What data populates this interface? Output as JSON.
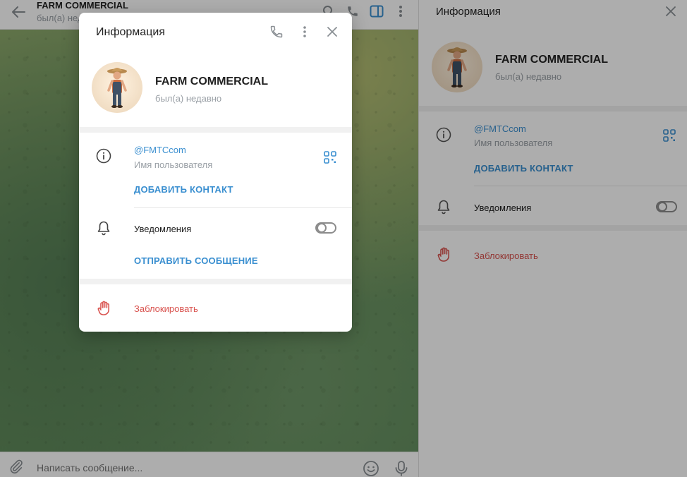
{
  "chat": {
    "title": "FARM COMMERCIAL",
    "subtitle": "был(а) недавно",
    "composer_placeholder": "Написать сообщение..."
  },
  "panel": {
    "title": "Информация",
    "name": "FARM COMMERCIAL",
    "status": "был(а) недавно",
    "username": "@FMTCcom",
    "username_label": "Имя пользователя",
    "add_contact": "ДОБАВИТЬ КОНТАКТ",
    "notifications": "Уведомления",
    "notifications_on": false,
    "block": "Заблокировать"
  },
  "modal": {
    "title": "Информация",
    "name": "FARM COMMERCIAL",
    "status": "был(а) недавно",
    "username": "@FMTCcom",
    "username_label": "Имя пользователя",
    "add_contact": "ДОБАВИТЬ КОНТАКТ",
    "notifications": "Уведомления",
    "notifications_on": false,
    "send_message": "ОТПРАВИТЬ СООБЩЕНИЕ",
    "block": "Заблокировать"
  },
  "colors": {
    "accent": "#3a8fd0",
    "danger": "#d9534f",
    "muted": "#9aa0a6",
    "separator": "#f1f1f1"
  },
  "icons": {
    "back": "arrow-left-icon",
    "search": "search-icon",
    "call": "phone-icon",
    "sidebar": "sidebar-toggle-icon",
    "more": "more-vertical-icon",
    "close": "close-icon",
    "info": "info-circle-icon",
    "qr": "qr-code-icon",
    "bell": "bell-icon",
    "block": "hand-stop-icon",
    "attach": "paperclip-icon",
    "emoji": "emoji-icon",
    "mic": "microphone-icon"
  }
}
